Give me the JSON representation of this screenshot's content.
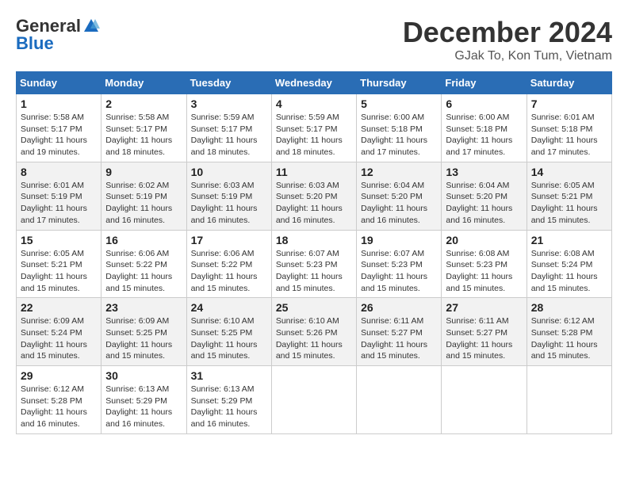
{
  "logo": {
    "general": "General",
    "blue": "Blue"
  },
  "title": "December 2024",
  "subtitle": "GJak To, Kon Tum, Vietnam",
  "days_of_week": [
    "Sunday",
    "Monday",
    "Tuesday",
    "Wednesday",
    "Thursday",
    "Friday",
    "Saturday"
  ],
  "weeks": [
    [
      {
        "day": "1",
        "sunrise": "5:58 AM",
        "sunset": "5:17 PM",
        "daylight": "11 hours and 19 minutes."
      },
      {
        "day": "2",
        "sunrise": "5:58 AM",
        "sunset": "5:17 PM",
        "daylight": "11 hours and 18 minutes."
      },
      {
        "day": "3",
        "sunrise": "5:59 AM",
        "sunset": "5:17 PM",
        "daylight": "11 hours and 18 minutes."
      },
      {
        "day": "4",
        "sunrise": "5:59 AM",
        "sunset": "5:17 PM",
        "daylight": "11 hours and 18 minutes."
      },
      {
        "day": "5",
        "sunrise": "6:00 AM",
        "sunset": "5:18 PM",
        "daylight": "11 hours and 17 minutes."
      },
      {
        "day": "6",
        "sunrise": "6:00 AM",
        "sunset": "5:18 PM",
        "daylight": "11 hours and 17 minutes."
      },
      {
        "day": "7",
        "sunrise": "6:01 AM",
        "sunset": "5:18 PM",
        "daylight": "11 hours and 17 minutes."
      }
    ],
    [
      {
        "day": "8",
        "sunrise": "6:01 AM",
        "sunset": "5:19 PM",
        "daylight": "11 hours and 17 minutes."
      },
      {
        "day": "9",
        "sunrise": "6:02 AM",
        "sunset": "5:19 PM",
        "daylight": "11 hours and 16 minutes."
      },
      {
        "day": "10",
        "sunrise": "6:03 AM",
        "sunset": "5:19 PM",
        "daylight": "11 hours and 16 minutes."
      },
      {
        "day": "11",
        "sunrise": "6:03 AM",
        "sunset": "5:20 PM",
        "daylight": "11 hours and 16 minutes."
      },
      {
        "day": "12",
        "sunrise": "6:04 AM",
        "sunset": "5:20 PM",
        "daylight": "11 hours and 16 minutes."
      },
      {
        "day": "13",
        "sunrise": "6:04 AM",
        "sunset": "5:20 PM",
        "daylight": "11 hours and 16 minutes."
      },
      {
        "day": "14",
        "sunrise": "6:05 AM",
        "sunset": "5:21 PM",
        "daylight": "11 hours and 15 minutes."
      }
    ],
    [
      {
        "day": "15",
        "sunrise": "6:05 AM",
        "sunset": "5:21 PM",
        "daylight": "11 hours and 15 minutes."
      },
      {
        "day": "16",
        "sunrise": "6:06 AM",
        "sunset": "5:22 PM",
        "daylight": "11 hours and 15 minutes."
      },
      {
        "day": "17",
        "sunrise": "6:06 AM",
        "sunset": "5:22 PM",
        "daylight": "11 hours and 15 minutes."
      },
      {
        "day": "18",
        "sunrise": "6:07 AM",
        "sunset": "5:23 PM",
        "daylight": "11 hours and 15 minutes."
      },
      {
        "day": "19",
        "sunrise": "6:07 AM",
        "sunset": "5:23 PM",
        "daylight": "11 hours and 15 minutes."
      },
      {
        "day": "20",
        "sunrise": "6:08 AM",
        "sunset": "5:23 PM",
        "daylight": "11 hours and 15 minutes."
      },
      {
        "day": "21",
        "sunrise": "6:08 AM",
        "sunset": "5:24 PM",
        "daylight": "11 hours and 15 minutes."
      }
    ],
    [
      {
        "day": "22",
        "sunrise": "6:09 AM",
        "sunset": "5:24 PM",
        "daylight": "11 hours and 15 minutes."
      },
      {
        "day": "23",
        "sunrise": "6:09 AM",
        "sunset": "5:25 PM",
        "daylight": "11 hours and 15 minutes."
      },
      {
        "day": "24",
        "sunrise": "6:10 AM",
        "sunset": "5:25 PM",
        "daylight": "11 hours and 15 minutes."
      },
      {
        "day": "25",
        "sunrise": "6:10 AM",
        "sunset": "5:26 PM",
        "daylight": "11 hours and 15 minutes."
      },
      {
        "day": "26",
        "sunrise": "6:11 AM",
        "sunset": "5:27 PM",
        "daylight": "11 hours and 15 minutes."
      },
      {
        "day": "27",
        "sunrise": "6:11 AM",
        "sunset": "5:27 PM",
        "daylight": "11 hours and 15 minutes."
      },
      {
        "day": "28",
        "sunrise": "6:12 AM",
        "sunset": "5:28 PM",
        "daylight": "11 hours and 15 minutes."
      }
    ],
    [
      {
        "day": "29",
        "sunrise": "6:12 AM",
        "sunset": "5:28 PM",
        "daylight": "11 hours and 16 minutes."
      },
      {
        "day": "30",
        "sunrise": "6:13 AM",
        "sunset": "5:29 PM",
        "daylight": "11 hours and 16 minutes."
      },
      {
        "day": "31",
        "sunrise": "6:13 AM",
        "sunset": "5:29 PM",
        "daylight": "11 hours and 16 minutes."
      },
      null,
      null,
      null,
      null
    ]
  ],
  "labels": {
    "sunrise": "Sunrise:",
    "sunset": "Sunset:",
    "daylight": "Daylight:"
  }
}
